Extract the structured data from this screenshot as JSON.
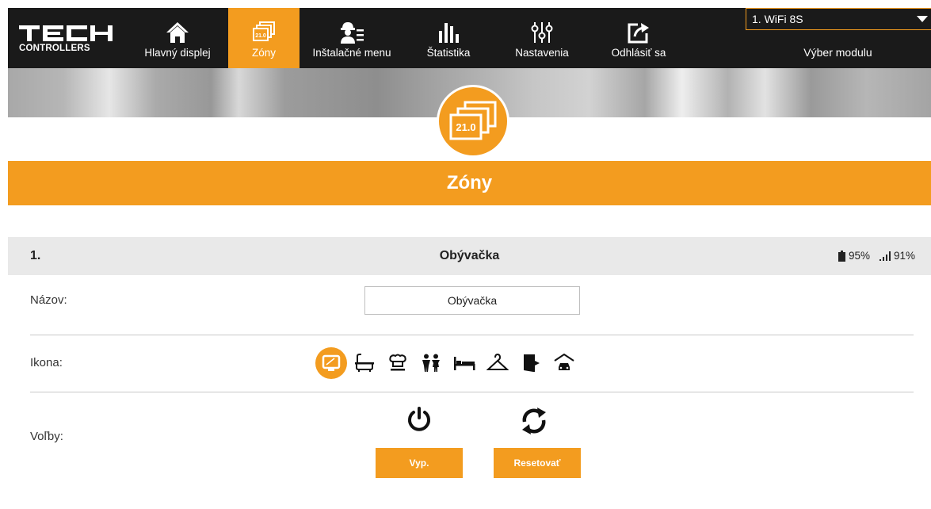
{
  "brand": {
    "logo_text": "TECH",
    "logo_sub": "CONTROLLERS"
  },
  "nav": {
    "items": [
      {
        "label": "Hlavný displej",
        "icon": "home-icon"
      },
      {
        "label": "Zóny",
        "icon": "zones-icon",
        "active": true
      },
      {
        "label": "Inštalačné menu",
        "icon": "installer-icon"
      },
      {
        "label": "Štatistika",
        "icon": "statistics-icon"
      },
      {
        "label": "Nastavenia",
        "icon": "settings-sliders-icon"
      },
      {
        "label": "Odhlásiť sa",
        "icon": "logout-icon"
      }
    ]
  },
  "module": {
    "selected": "1. WiFi 8S",
    "label": "Výber modulu"
  },
  "badge": {
    "text": "21.0"
  },
  "page": {
    "title": "Zóny"
  },
  "zone": {
    "number": "1.",
    "name": "Obývačka",
    "battery": "95%",
    "signal": "91%"
  },
  "form": {
    "name_label": "Názov:",
    "name_value": "Obývačka",
    "icon_label": "Ikona:",
    "icons": [
      "tv-icon",
      "bathtub-icon",
      "kitchen-icon",
      "children-icon",
      "bed-icon",
      "hanger-icon",
      "door-icon",
      "garage-icon"
    ],
    "options_label": "Voľby:",
    "off_button": "Vyp.",
    "reset_button": "Resetovať"
  },
  "colors": {
    "accent": "#f39c1f",
    "topbar": "#1a1a1a",
    "zone_header": "#e9e9e9"
  }
}
